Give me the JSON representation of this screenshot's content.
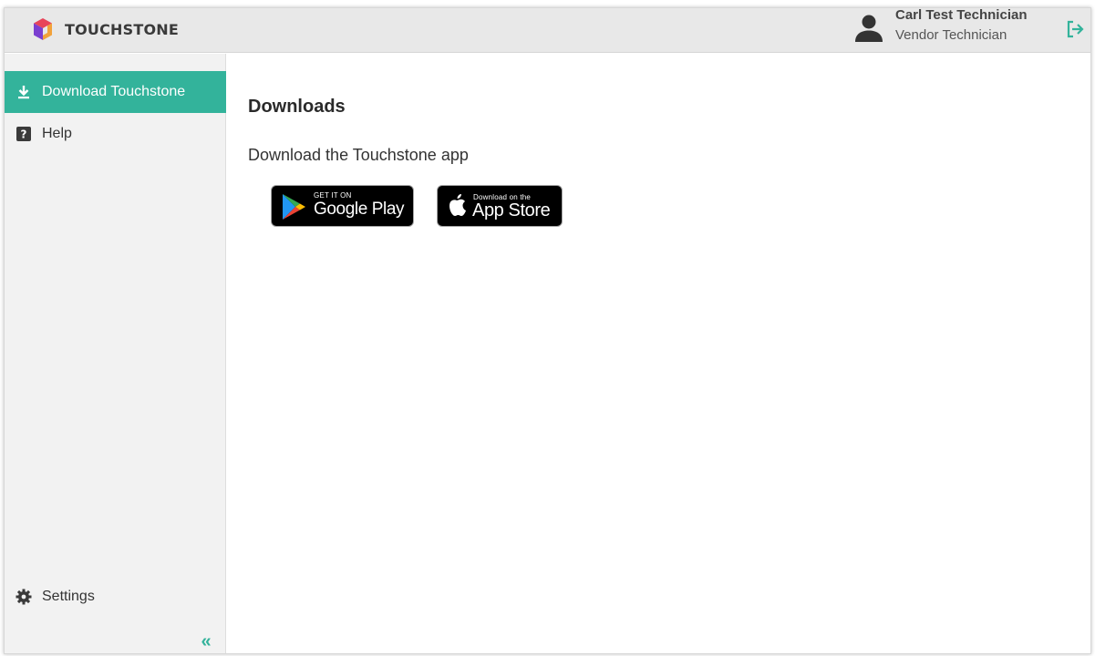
{
  "app": {
    "brand_name": "TOUCHSTONE"
  },
  "user": {
    "name": "Carl Test Technician",
    "role": "Vendor Technician"
  },
  "sidebar": {
    "items": [
      {
        "label": "Download Touchstone",
        "icon": "download-icon",
        "active": true
      },
      {
        "label": "Help",
        "icon": "help-icon",
        "active": false
      }
    ],
    "settings_label": "Settings",
    "collapse_glyph": "«"
  },
  "main": {
    "title": "Downloads",
    "subtitle": "Download the Touchstone app",
    "badges": {
      "google": {
        "small": "GET IT ON",
        "big": "Google Play"
      },
      "apple": {
        "small": "Download on the",
        "big": "App Store"
      }
    }
  },
  "colors": {
    "accent": "#33b39b",
    "topbar": "#e8e8e8",
    "sidebar": "#f2f2f2"
  }
}
